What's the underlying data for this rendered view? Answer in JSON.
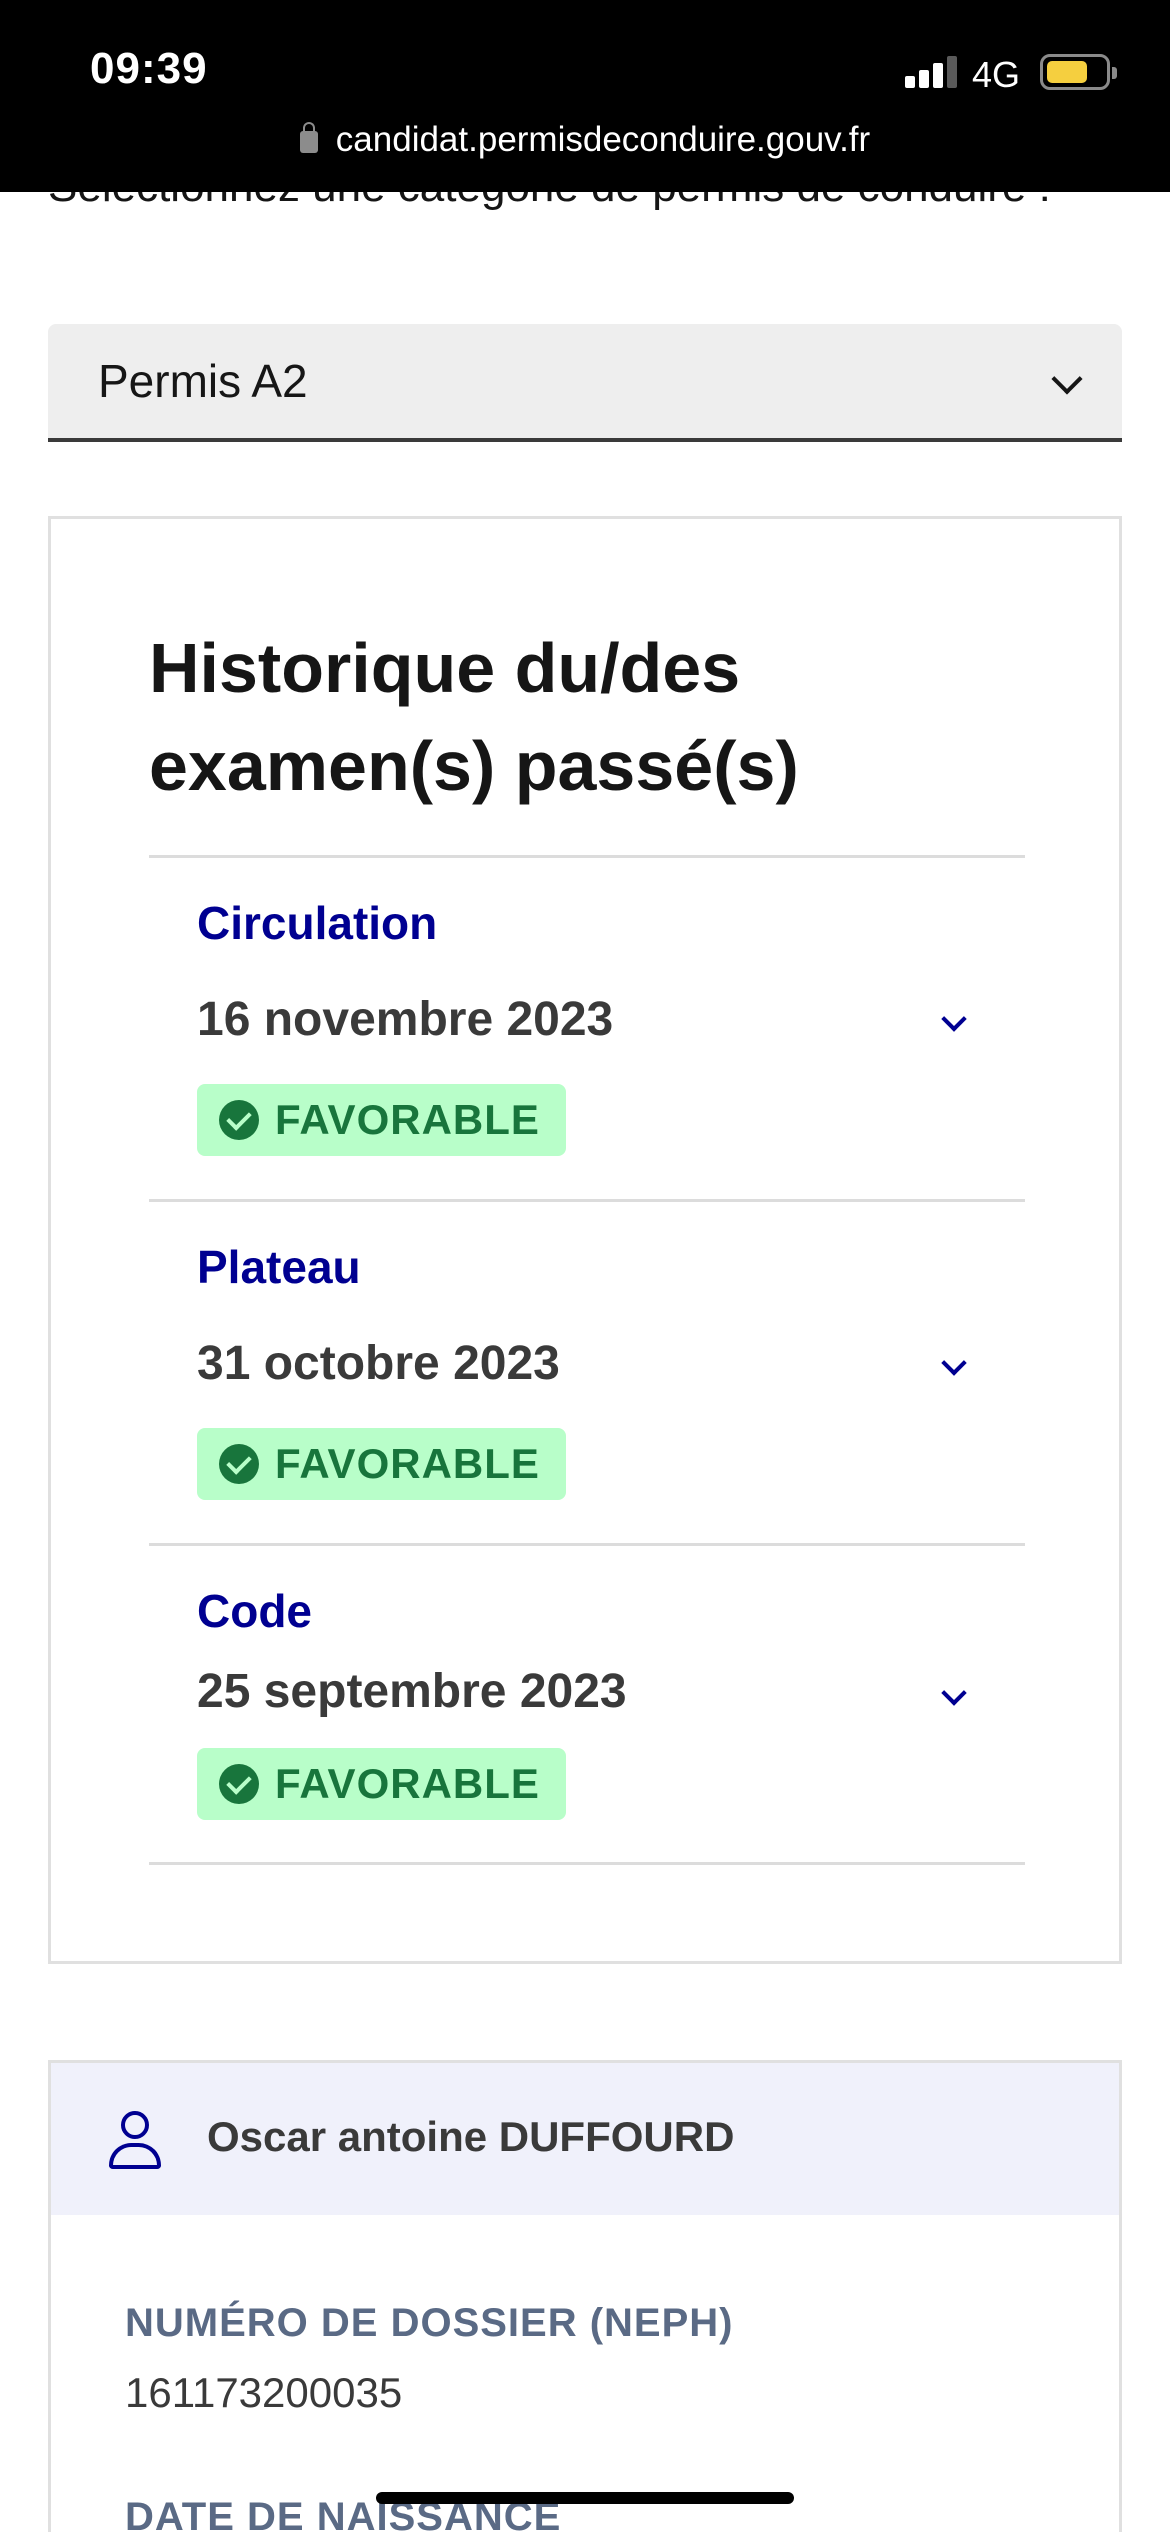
{
  "status_bar": {
    "time": "09:39",
    "network": "4G",
    "url": "candidat.permisdeconduire.gouv.fr"
  },
  "category": {
    "prompt": "Sélectionnez une catégorie de permis de conduire :",
    "selected": "Permis A2"
  },
  "history": {
    "title": "Historique du/des examen(s) passé(s)",
    "exams": [
      {
        "name": "Circulation",
        "date": "16 novembre 2023",
        "result": "FAVORABLE"
      },
      {
        "name": "Plateau",
        "date": "31 octobre 2023",
        "result": "FAVORABLE"
      },
      {
        "name": "Code",
        "date": "25 septembre 2023",
        "result": "FAVORABLE"
      }
    ]
  },
  "profile": {
    "name": "Oscar antoine DUFFOURD",
    "neph_label": "NUMÉRO DE DOSSIER (NEPH)",
    "neph_value": "161173200035",
    "birth_label": "DATE DE NAISSANCE"
  },
  "colors": {
    "accent": "#000091",
    "success_bg": "#b8fec9",
    "success_text": "#18753c"
  }
}
